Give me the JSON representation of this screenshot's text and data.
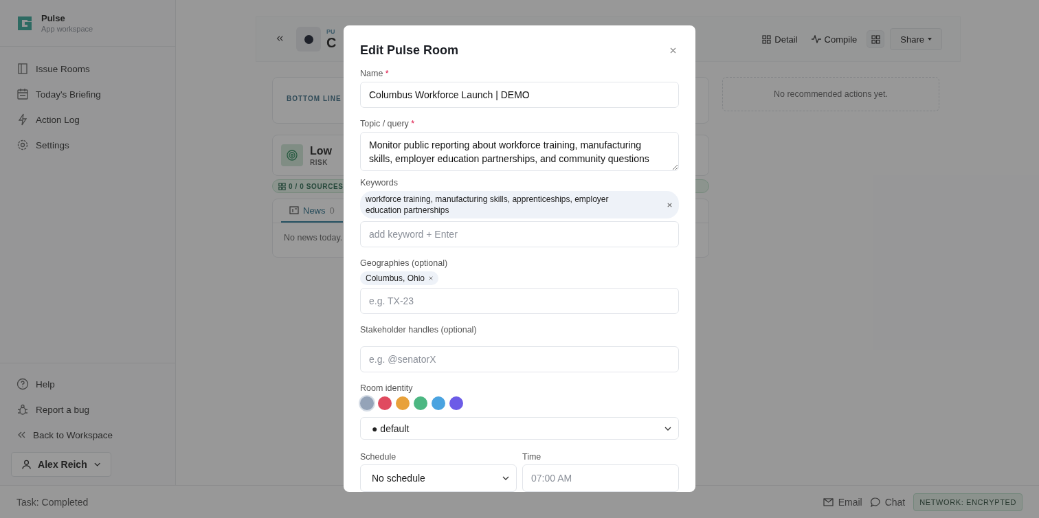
{
  "app": {
    "name": "Pulse",
    "subtitle": "App workspace"
  },
  "nav": [
    {
      "label": "Issue Rooms"
    },
    {
      "label": "Today's Briefing"
    },
    {
      "label": "Action Log"
    },
    {
      "label": "Settings"
    }
  ],
  "footer_nav": [
    {
      "label": "Help"
    },
    {
      "label": "Report a bug"
    },
    {
      "label": "Back to Workspace"
    }
  ],
  "user": {
    "name": "Alex Reich"
  },
  "header": {
    "eyebrow": "PU",
    "title": "C",
    "actions": [
      {
        "label": "Detail"
      },
      {
        "label": "Compile"
      }
    ],
    "share": "Share"
  },
  "bottom_line": {
    "label": "BOTTOM LINE"
  },
  "risk": {
    "level": "Low",
    "label": "RISK"
  },
  "sources": "0 / 0 SOURCES",
  "tabs": [
    {
      "label": "News",
      "count": "0",
      "selected": true
    }
  ],
  "news_empty": "No news today.",
  "recommended_empty": "No recommended actions yet.",
  "status_bar": {
    "task": "Task: Completed",
    "links": [
      {
        "label": "Email"
      },
      {
        "label": "Chat"
      }
    ],
    "network": "NETWORK: ENCRYPTED"
  },
  "modal": {
    "title": "Edit Pulse Room",
    "name": {
      "label": "Name",
      "required_mark": "*",
      "value": "Columbus Workforce Launch | DEMO"
    },
    "topic": {
      "label": "Topic / query",
      "required_mark": "*",
      "value": "Monitor public reporting about workforce training, manufacturing skills, employer education partnerships, and community questions"
    },
    "keywords": {
      "label": "Keywords",
      "tags": [
        "workforce training, manufacturing skills, apprenticeships, employer education partnerships"
      ],
      "placeholder": "add keyword + Enter"
    },
    "geographies": {
      "label": "Geographies (optional)",
      "tags": [
        "Columbus, Ohio"
      ],
      "placeholder": "e.g. TX-23"
    },
    "stakeholders": {
      "label": "Stakeholder handles (optional)",
      "placeholder": "e.g. @senatorX"
    },
    "identity": {
      "label": "Room identity",
      "swatches": [
        {
          "color": "#94a3b8",
          "selected": true
        },
        {
          "color": "#e04a5f",
          "selected": false
        },
        {
          "color": "#e8a13a",
          "selected": false
        },
        {
          "color": "#4cb782",
          "selected": false
        },
        {
          "color": "#4aa3e0",
          "selected": false
        },
        {
          "color": "#6c5ce7",
          "selected": false
        }
      ],
      "icon_value": "● default"
    },
    "schedule": {
      "label": "Schedule",
      "value": "No schedule"
    },
    "time": {
      "label": "Time",
      "placeholder": "07:00 AM"
    }
  }
}
